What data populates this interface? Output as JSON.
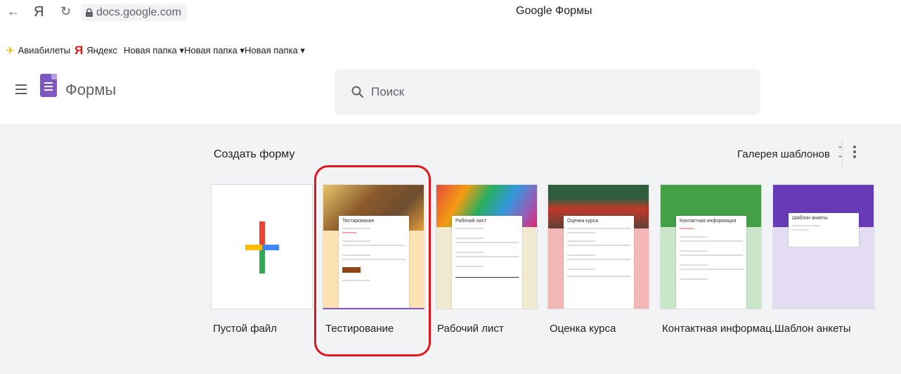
{
  "browser": {
    "back": "←",
    "yandex": "Я",
    "reload": "↻",
    "url": "docs.google.com",
    "page_title": "Google Формы"
  },
  "bookmarks": [
    {
      "icon": "✈",
      "label": "Авиабилеты"
    },
    {
      "icon": "Я",
      "label": "Яндекс"
    },
    {
      "label": "Новая папка ▾"
    },
    {
      "label": "Новая папка ▾"
    },
    {
      "label": "Новая папка ▾"
    }
  ],
  "header": {
    "app_name": "Формы",
    "search_placeholder": "Поиск"
  },
  "gallery": {
    "section_title": "Создать форму",
    "gallery_button": "Галерея шаблонов",
    "templates": [
      {
        "label": "Пустой файл"
      },
      {
        "label": "Тестирование",
        "preview_title": "Тестирование",
        "highlighted": true
      },
      {
        "label": "Рабочий лист",
        "preview_title": "Рабочий лист"
      },
      {
        "label": "Оценка курса",
        "preview_title": "Оценка курса"
      },
      {
        "label": "Контактная информац...",
        "preview_title": "Контактная информация"
      },
      {
        "label": "Шаблон анкеты",
        "preview_title": "Шаблон анкеты"
      }
    ]
  },
  "colors": {
    "forms_purple": "#7e57c2",
    "highlight_red": "#e0161e",
    "background_gray": "#f1f3f4"
  }
}
